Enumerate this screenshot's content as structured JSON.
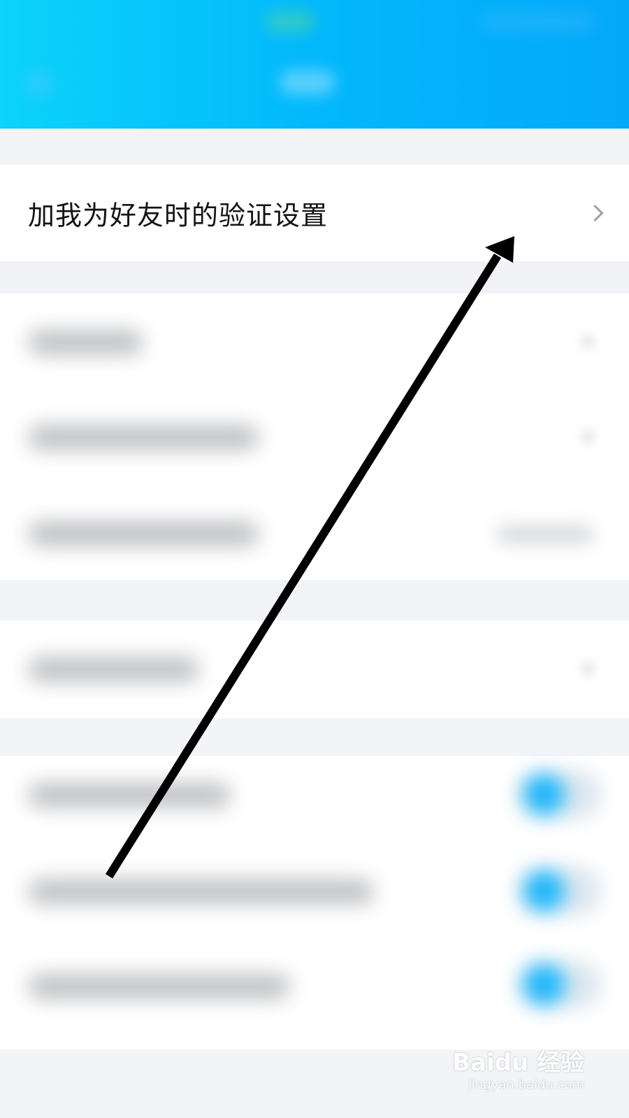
{
  "settings": {
    "friend_verification_label": "加我为好友时的验证设置"
  },
  "watermark": {
    "brand": "Baidu 经验",
    "site": "jingyan.baidu.com"
  },
  "colors": {
    "header_start": "#0bd3fb",
    "header_end": "#04a8fa",
    "toggle_on": "#1fb6fb",
    "annotation_arrow": "#000000"
  },
  "icons": {
    "row_chevron": "chevron-right-icon",
    "annotation": "arrow-icon"
  }
}
